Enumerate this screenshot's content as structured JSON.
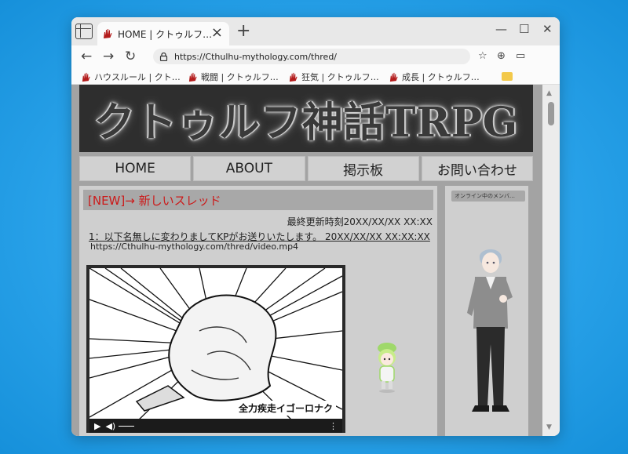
{
  "browser": {
    "tab_title": "HOME | クトゥルフ…",
    "url": "https://Cthulhu-mythology.com/thred/",
    "bookmarks": [
      {
        "label": "ハウスルール | クト…"
      },
      {
        "label": "戦闘 | クトゥルフ…"
      },
      {
        "label": "狂気 | クトゥルフ…"
      },
      {
        "label": "成長 | クトゥルフ…"
      }
    ]
  },
  "site": {
    "banner_title": "クトゥルフ神話TRPG",
    "nav": [
      "HOME",
      "ABOUT",
      "掲示板",
      "お問い合わせ"
    ]
  },
  "thread": {
    "title": "[NEW]→ 新しいスレッド",
    "updated": "最終更新時刻20XX/XX/XX XX:XX",
    "post_header": "1：以下名無しに変わりましてKPがお送りいたします。 20XX/XX/XX XX:XX:XX",
    "post_url": "https://Cthulhu-mythology.com/thred/video.mp4",
    "video_caption": "全力疾走イゴーロナク"
  },
  "sidebar": {
    "online_label": "オンライン中のメンバ…"
  },
  "colors": {
    "accent_red": "#cc1a1a",
    "desktop_blue": "#2aa3ea"
  }
}
